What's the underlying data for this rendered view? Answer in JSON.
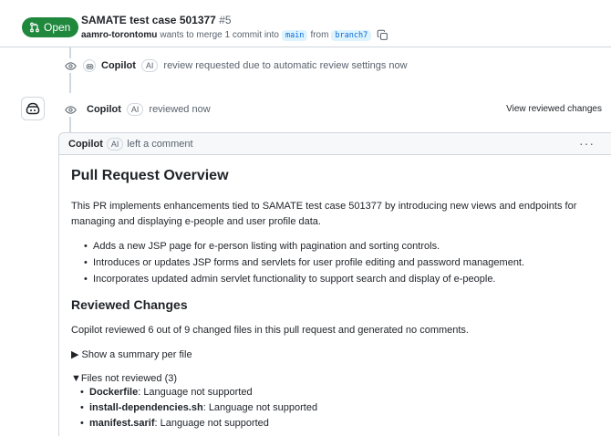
{
  "pr": {
    "state": "Open",
    "title": "SAMATE test case 501377",
    "number": "#5",
    "author": "aamro-torontomu",
    "merge_text": "wants to merge 1 commit into",
    "base_branch": "main",
    "from_text": "from",
    "head_branch": "branch7"
  },
  "events": {
    "review_request": {
      "actor": "Copilot",
      "badge": "AI",
      "text": "review requested due to automatic review settings now"
    },
    "review": {
      "actor": "Copilot",
      "badge": "AI",
      "text": "reviewed now",
      "link": "View reviewed changes"
    }
  },
  "comment": {
    "author": "Copilot",
    "badge": "AI",
    "action": "left a comment",
    "menu": "···",
    "overview_title": "Pull Request Overview",
    "overview_text": "This PR implements enhancements tied to SAMATE test case 501377 by introducing new views and endpoints for managing and displaying e-people and user profile data.",
    "bullets": [
      "Adds a new JSP page for e-person listing with pagination and sorting controls.",
      "Introduces or updates JSP forms and servlets for user profile editing and password management.",
      "Incorporates updated admin servlet functionality to support search and display of e-people."
    ],
    "changes_title": "Reviewed Changes",
    "changes_text": "Copilot reviewed 6 out of 9 changed files in this pull request and generated no comments.",
    "summary_toggle": "▶ Show a summary per file",
    "not_reviewed_label": "▼Files not reviewed (3)",
    "files_not_reviewed": [
      {
        "name": "Dockerfile",
        "reason": ": Language not supported"
      },
      {
        "name": "install-dependencies.sh",
        "reason": ": Language not supported"
      },
      {
        "name": "manifest.sarif",
        "reason": ": Language not supported"
      }
    ]
  },
  "icons": {
    "state": "git-pull-request-icon",
    "copy": "copy-icon",
    "eye": "eye-icon",
    "bot": "copilot-icon"
  },
  "colors": {
    "open_green": "#1f883d",
    "branch_bg": "#ddf4ff",
    "branch_fg": "#0969da",
    "border": "#d0d7de",
    "muted": "#59636e"
  }
}
